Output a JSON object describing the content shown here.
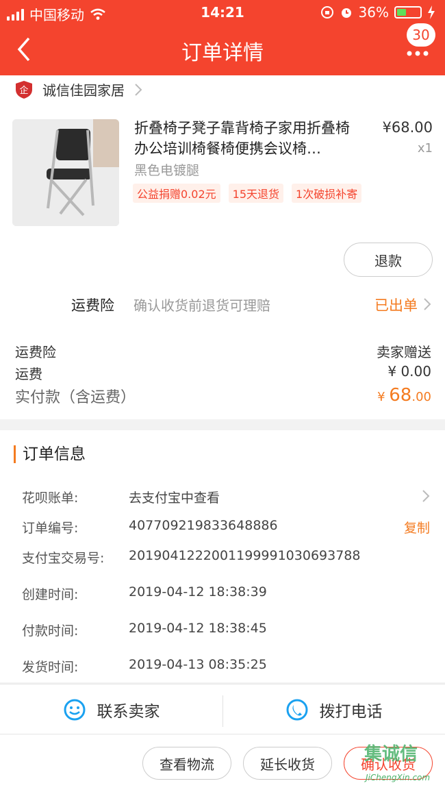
{
  "status_bar": {
    "carrier": "中国移动",
    "time": "14:21",
    "battery": "36%"
  },
  "nav": {
    "title": "订单详情",
    "badge_count": "30"
  },
  "shop": {
    "name": "诚信佳园家居"
  },
  "product": {
    "title": "折叠椅子凳子靠背椅子家用折叠椅办公培训椅餐椅便携会议椅…",
    "price": "¥68.00",
    "qty": "x1",
    "sku": "黑色电镀腿",
    "tags": [
      "公益捐赠0.02元",
      "15天退货",
      "1次破损补寄"
    ],
    "refund_label": "退款"
  },
  "insurance": {
    "label": "运费险",
    "desc": "确认收货前退货可理赔",
    "status": "已出单"
  },
  "fees": {
    "insurance_label": "运费险",
    "insurance_value": "卖家赠送",
    "shipping_label": "运费",
    "shipping_value": "¥ 0.00",
    "paid_label": "实付款（含运费）",
    "paid_currency": "¥",
    "paid_int": "68",
    "paid_dec": ".00"
  },
  "order_info": {
    "title": "订单信息",
    "huabei_label": "花呗账单:",
    "huabei_value": "去支付宝中查看",
    "order_no_label": "订单编号:",
    "order_no": "407709219833648886",
    "copy_label": "复制",
    "alipay_label": "支付宝交易号:",
    "alipay_no": "2019041222001199991030693788",
    "created_label": "创建时间:",
    "created": "2019-04-12 18:38:39",
    "paid_label": "付款时间:",
    "paid": "2019-04-12 18:38:45",
    "shipped_label": "发货时间:",
    "shipped": "2019-04-13 08:35:25"
  },
  "contact": {
    "seller_label": "联系卖家",
    "call_label": "拨打电话"
  },
  "actions": {
    "logistics": "查看物流",
    "extend": "延长收货",
    "confirm": "确认收货"
  },
  "watermark": {
    "logo": "集诚信",
    "url": "JiChengXin.com"
  },
  "colors": {
    "brand": "#f4442e",
    "accent": "#f47b20"
  }
}
